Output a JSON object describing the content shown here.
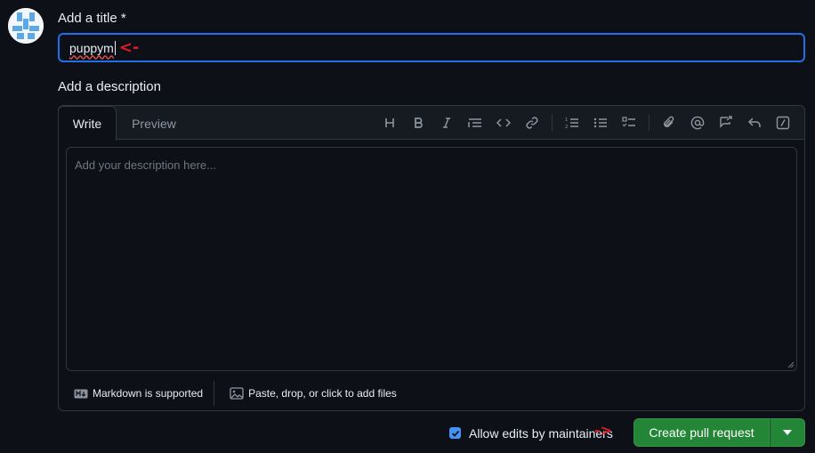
{
  "form": {
    "title_label": "Add a title *",
    "title_value": "puppym",
    "description_label": "Add a description"
  },
  "editor": {
    "tabs": [
      {
        "label": "Write",
        "active": true
      },
      {
        "label": "Preview",
        "active": false
      }
    ],
    "toolbar": [
      "heading-icon",
      "bold-icon",
      "italic-icon",
      "quote-icon",
      "code-icon",
      "link-icon",
      "numbered-list-icon",
      "unordered-list-icon",
      "task-list-icon",
      "attach-icon",
      "mention-icon",
      "reference-icon",
      "reply-icon",
      "slash-command-icon"
    ],
    "placeholder": "Add your description here...",
    "markdown_note": "Markdown is supported",
    "attach_note": "Paste, drop, or click to add files"
  },
  "footer": {
    "allow_edits_label": "Allow edits by maintainers",
    "allow_edits_checked": true,
    "create_button_label": "Create pull request"
  },
  "annotations": {
    "title_arrow": "<-",
    "button_arrow": "->"
  },
  "colors": {
    "background": "#0d1117",
    "accent_blue": "#1f6feb",
    "primary_green": "#238636",
    "annotation_red": "#e01b24"
  }
}
